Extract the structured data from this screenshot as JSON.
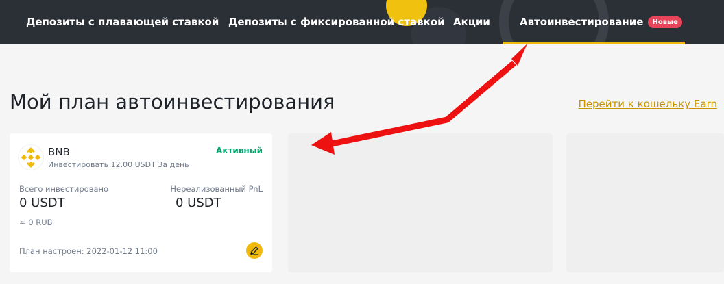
{
  "nav": {
    "tabs": [
      {
        "label": "Депозиты с плавающей ставкой"
      },
      {
        "label": "Депозиты с фиксированной ставкой"
      },
      {
        "label": "Акции"
      },
      {
        "label": "Автоинвестирование",
        "badge": "Новые",
        "active": true
      }
    ]
  },
  "page": {
    "title": "Мой план автоинвестирования",
    "earn_link": "Перейти к кошельку Earn"
  },
  "plan_card": {
    "coin": "BNB",
    "coin_icon": "bnb-logo-icon",
    "subtitle": "Инвестировать 12.00 USDT За день",
    "status": "Активный",
    "invested_label": "Всего инвестировано",
    "invested_value": "0 USDT",
    "invested_fiat": "≈ 0 RUB",
    "pnl_label": "Нереализованный PnL",
    "pnl_value": "0 USDT",
    "configured": "План настроен: 2022-01-12 11:00",
    "edit_icon": "pencil-icon"
  },
  "colors": {
    "nav_bg": "#2b2f36",
    "accent": "#f0b90b",
    "badge": "#e8445a",
    "status_green": "#03a66d",
    "annotation_arrow": "#ee1111"
  }
}
